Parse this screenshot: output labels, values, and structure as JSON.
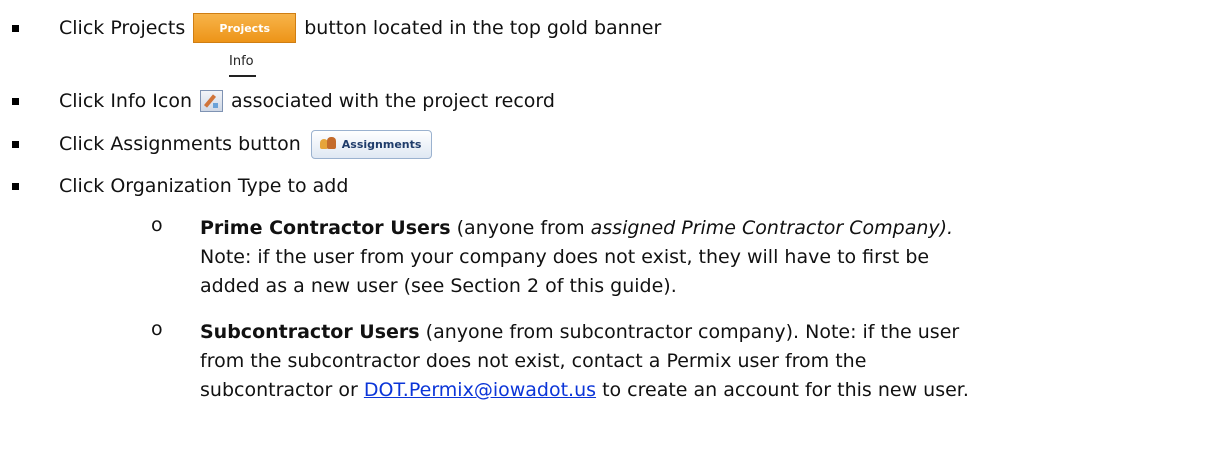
{
  "steps": [
    {
      "before": "Click Projects",
      "button_label": "Projects",
      "after": "button located in the top gold banner"
    },
    {
      "caption": "Info",
      "before": "Click Info Icon",
      "after": "associated with the project record"
    },
    {
      "before": "Click Assignments button",
      "button_label": "Assignments"
    },
    {
      "text": "Click Organization Type to add"
    }
  ],
  "sub_items": [
    {
      "marker": "o",
      "bold": "Prime Contractor Users",
      "part1": " (anyone from ",
      "italic": "assigned Prime Contractor Company).",
      "part2": "Note:  if the user from your company does not exist, they will have to first be",
      "part3": "added as a new user (see Section 2 of this guide)."
    },
    {
      "marker": "o",
      "bold": "Subcontractor Users",
      "part1": " (anyone from subcontractor company).  Note: if the user",
      "part2": "from the subcontractor does not exist, contact a Permix user from the",
      "part3_before": "subcontractor or ",
      "link": "DOT.Permix@iowadot.us",
      "part3_after": " to create an account for this new user."
    }
  ],
  "icons": {
    "info": "edit-note-icon",
    "assignments": "people-icon"
  },
  "colors": {
    "projects_button": "#ed9418",
    "link": "#0b35d8"
  }
}
